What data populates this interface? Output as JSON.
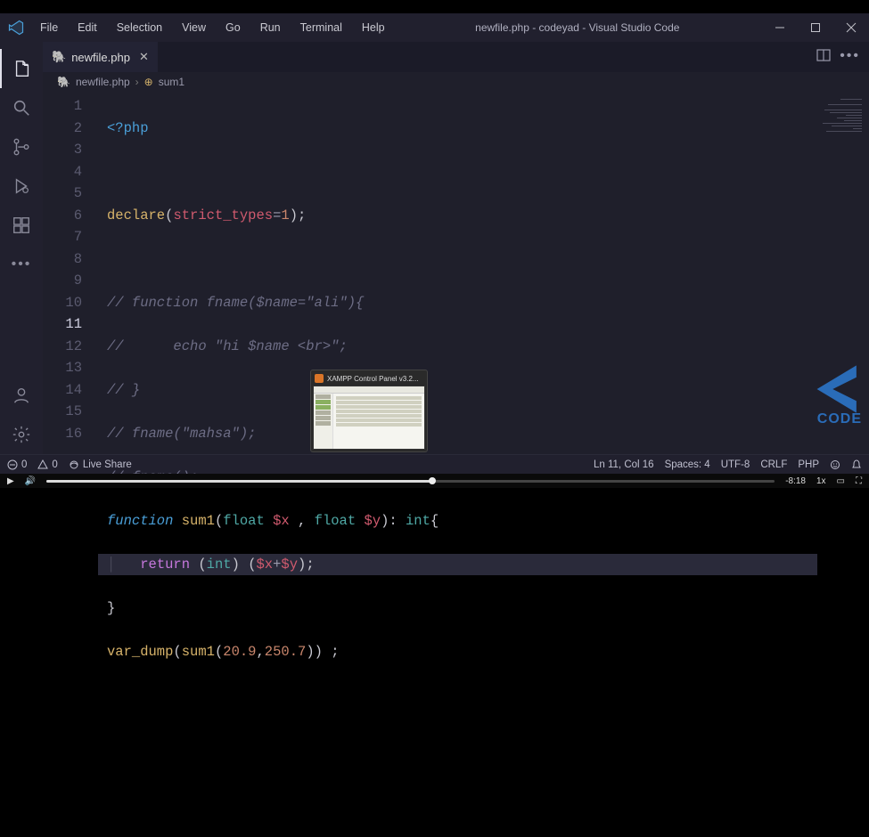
{
  "title": "newfile.php - codeyad - Visual Studio Code",
  "menus": [
    "File",
    "Edit",
    "Selection",
    "View",
    "Go",
    "Run",
    "Terminal",
    "Help"
  ],
  "tab": {
    "name": "newfile.php"
  },
  "breadcrumb": {
    "file": "newfile.php",
    "symbol": "sum1"
  },
  "code": {
    "lines": [
      {
        "n": 1,
        "t": "php-open"
      },
      {
        "n": 2,
        "t": "blank"
      },
      {
        "n": 3,
        "t": "declare"
      },
      {
        "n": 4,
        "t": "blank"
      },
      {
        "n": 5,
        "t": "cmt",
        "v": "// function fname($name=\"ali\"){"
      },
      {
        "n": 6,
        "t": "cmt",
        "v": "//      echo \"hi $name <br>\";"
      },
      {
        "n": 7,
        "t": "cmt",
        "v": "// }"
      },
      {
        "n": 8,
        "t": "cmt",
        "v": "// fname(\"mahsa\");"
      },
      {
        "n": 9,
        "t": "cmt",
        "v": "// fname();"
      },
      {
        "n": 10,
        "t": "func-sig"
      },
      {
        "n": 11,
        "t": "return",
        "active": true
      },
      {
        "n": 12,
        "t": "close-brace"
      },
      {
        "n": 13,
        "t": "var-dump"
      },
      {
        "n": 14,
        "t": "blank"
      },
      {
        "n": 15,
        "t": "blank"
      },
      {
        "n": 16,
        "t": "blank"
      }
    ],
    "text": {
      "php_open": "<?php",
      "declare": "declare",
      "strict_types": "strict_types",
      "eq": "=",
      "one": "1",
      "function": "function",
      "sum1": "sum1",
      "float": "float",
      "int": "int",
      "x": "$x",
      "y": "$y",
      "return": "return",
      "cast_int": "int",
      "plus": "+",
      "var_dump": "var_dump",
      "num_a": "20.9",
      "num_b": "250.7",
      "brace_close": "}"
    }
  },
  "status": {
    "remote": "0",
    "errors": "0",
    "warnings": "0",
    "liveshare": "Live Share",
    "ln_col": "Ln 11, Col 16",
    "spaces": "Spaces: 4",
    "encoding": "UTF-8",
    "eol": "CRLF",
    "lang": "PHP"
  },
  "thumb": {
    "title": "XAMPP Control Panel v3.2..."
  },
  "watermark": "CODE",
  "player": {
    "time_left": "-8:18",
    "rate": "1x"
  }
}
